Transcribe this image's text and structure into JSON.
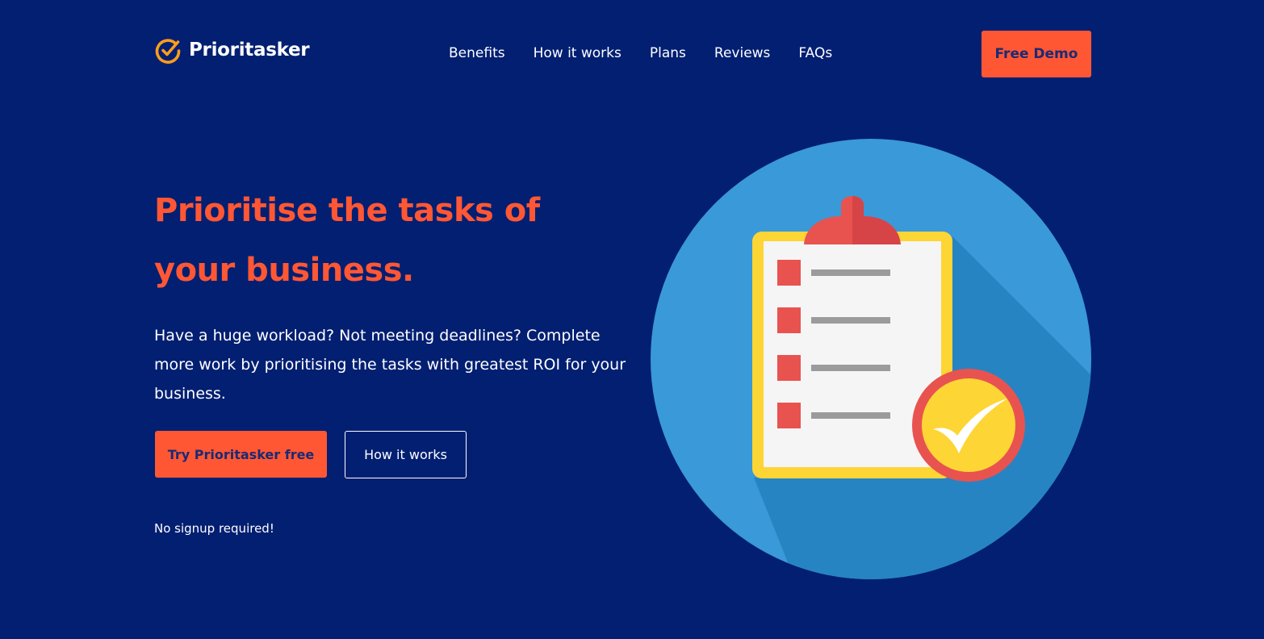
{
  "header": {
    "brand": "Prioritasker",
    "nav": [
      "Benefits",
      "How it works",
      "Plans",
      "Reviews",
      "FAQs"
    ],
    "demo_button": "Free Demo"
  },
  "hero": {
    "title": "Prioritise the tasks of your business.",
    "description": "Have a huge workload? Not meeting deadlines? Complete more work by prioritising the tasks with greatest ROI for your business.",
    "primary_button": "Try Prioritasker free",
    "secondary_button": "How it works",
    "note": "No signup required!"
  },
  "icons": {
    "logo": "check-circle-icon",
    "illustration": "clipboard-checklist-icon"
  },
  "colors": {
    "background": "#021f72",
    "accent": "#ff5734",
    "circle": "#3a99d8",
    "clipboard_frame": "#fdd535",
    "checkbox": "#e8534f",
    "badge": "#fdd535"
  }
}
